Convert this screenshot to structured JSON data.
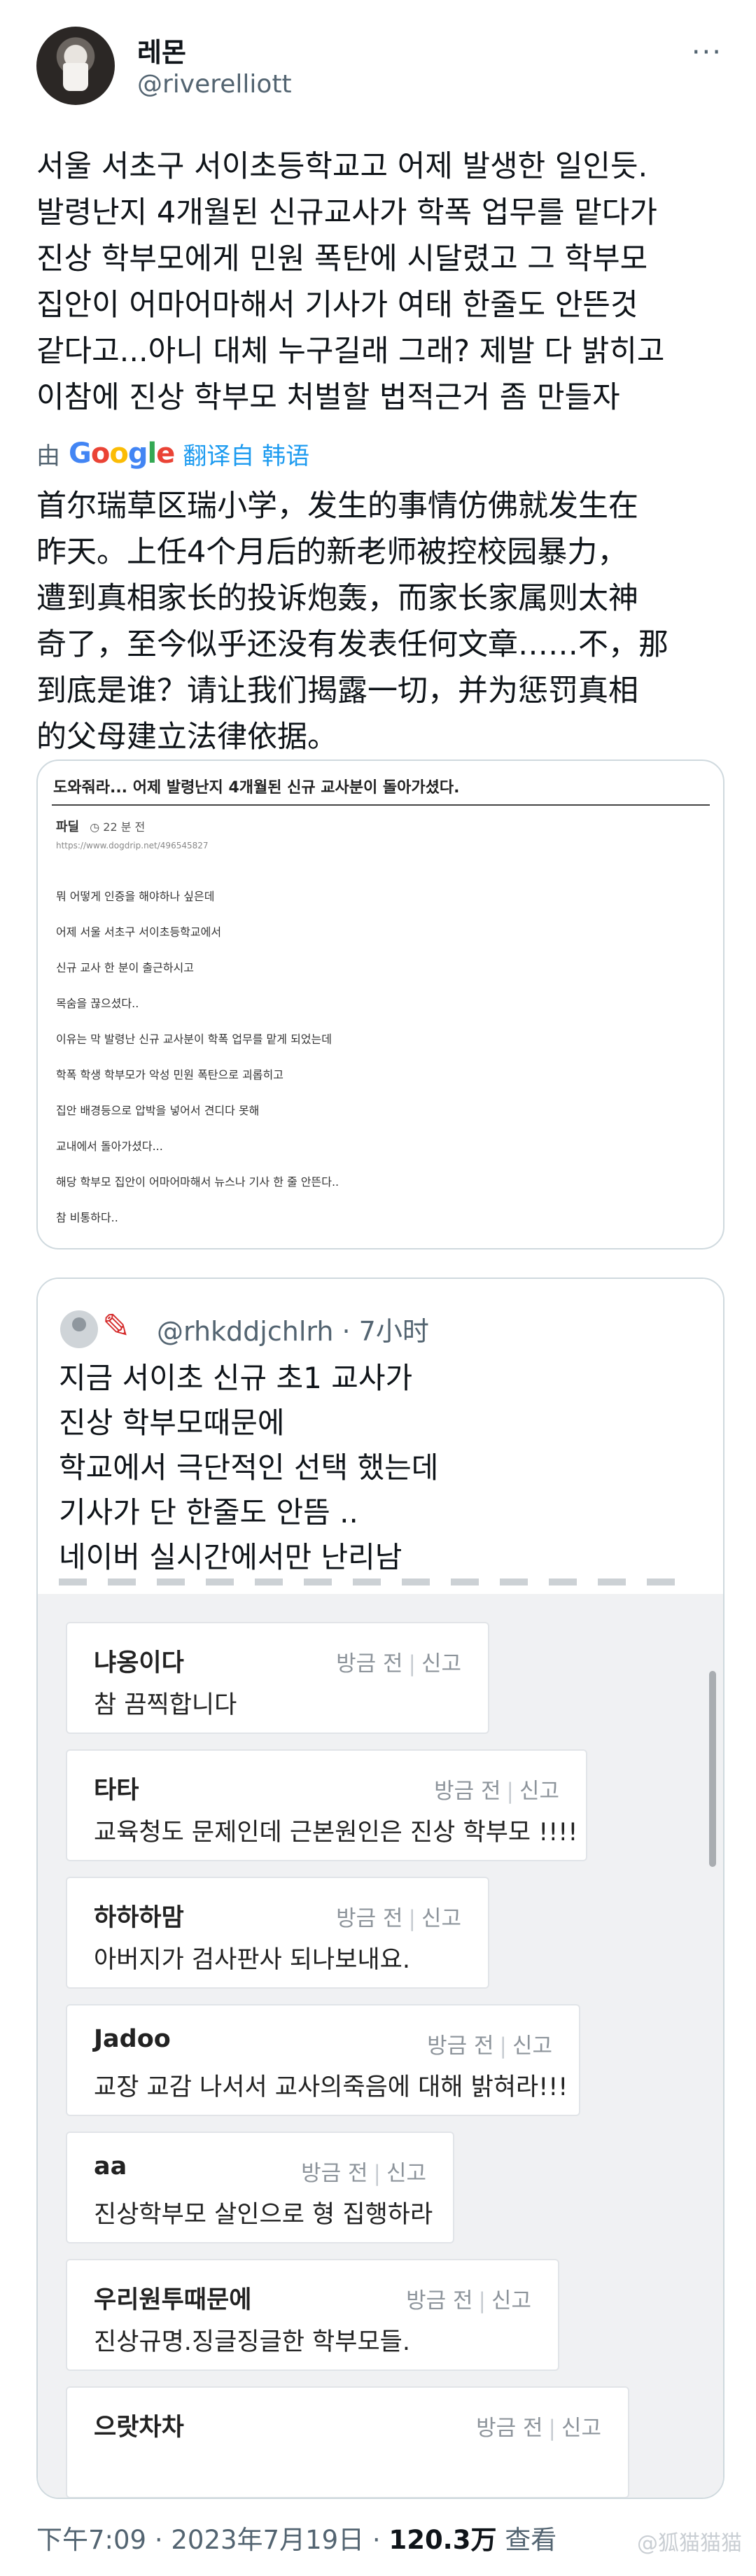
{
  "header": {
    "name": "레몬",
    "handle": "@riverelliott",
    "more": "···"
  },
  "tweet": {
    "lines": [
      "서울 서초구 서이초등학교고 어제 발생한 일인듯.",
      "발령난지 4개월된 신규교사가 학폭 업무를 맡다가",
      "진상 학부모에게 민원 폭탄에 시달렸고 그 학부모",
      "집안이 어마어마해서 기사가 여태 한줄도 안뜬것",
      "같다고...아니 대체 누구길래 그래? 제발 다 밝히고",
      "이참에 진상 학부모 처벌할 법적근거 좀 만들자"
    ],
    "translate_by": "由",
    "translate_link": "翻译自 韩语",
    "translation": [
      "首尔瑞草区瑞小学，发生的事情仿佛就发生在",
      "昨天。上任4个月后的新老师被控校园暴力，",
      "遭到真相家长的投诉炮轰，而家长家属则太神",
      "奇了，至今似乎还没有发表任何文章……不，那",
      "到底是谁？请让我们揭露一切，并为惩罚真相",
      "的父母建立法律依据。"
    ]
  },
  "card1": {
    "title": "도와줘라... 어제 발령난지 4개월된 신규 교사분이 돌아가셨다.",
    "board": "파딜",
    "time": "22 분 전",
    "url": "https://www.dogdrip.net/496545827",
    "lines": [
      "뭐 어떻게 인증을 해야하나 싶은데",
      "어제 서울 서초구 서이초등학교에서",
      "신규 교사 한 분이 출근하시고",
      "목숨을 끊으셨다..",
      "이유는 막 발령난 신규 교사분이 학폭 업무를 맡게 되었는데",
      "학폭 학생 학부모가 악성 민원 폭탄으로 괴롭히고",
      "집안 배경등으로 압박을 넣어서 견디다 못해",
      "교내에서 돌아가셨다...",
      "해당 학부모 집안이 어마어마해서 뉴스나 기사 한 줄 안뜬다..",
      "참 비통하다.."
    ]
  },
  "quote": {
    "handle": "@rhkddjchlrh · 7小时",
    "lines": [
      "지금 서이초 신규 초1 교사가",
      "진상 학부모때문에",
      "학교에서 극단적인 선택 했는데",
      "기사가 단 한줄도 안뜸 ..",
      "네이버 실시간에서만 난리남"
    ]
  },
  "comments": [
    {
      "user": "냐옹이다",
      "text": "참 끔찍합니다",
      "time": "방금 전",
      "report": "신고"
    },
    {
      "user": "타타",
      "text": "교육청도 문제인데 근본원인은 진상 학부모 !!!!",
      "time": "방금 전",
      "report": "신고"
    },
    {
      "user": "하하하맘",
      "text": "아버지가 검사판사 되나보내요.",
      "time": "방금 전",
      "report": "신고"
    },
    {
      "user": "Jadoo",
      "text": "교장 교감 나서서 교사의죽음에 대해 밝혀라!!!",
      "time": "방금 전",
      "report": "신고"
    },
    {
      "user": "aa",
      "text": "진상학부모 살인으로 형 집행하라",
      "time": "방금 전",
      "report": "신고"
    },
    {
      "user": "우리원투때문에",
      "text": "진상규명.징글징글한 학부모들.",
      "time": "방금 전",
      "report": "신고"
    },
    {
      "user": "으랏차차",
      "text": "",
      "time": "방금 전",
      "report": "신고"
    }
  ],
  "footer": {
    "time": "下午7:09 · 2023年7月19日 · ",
    "views": "120.3万",
    "views_label": " 查看"
  },
  "watermark": "@狐猫猫猫"
}
